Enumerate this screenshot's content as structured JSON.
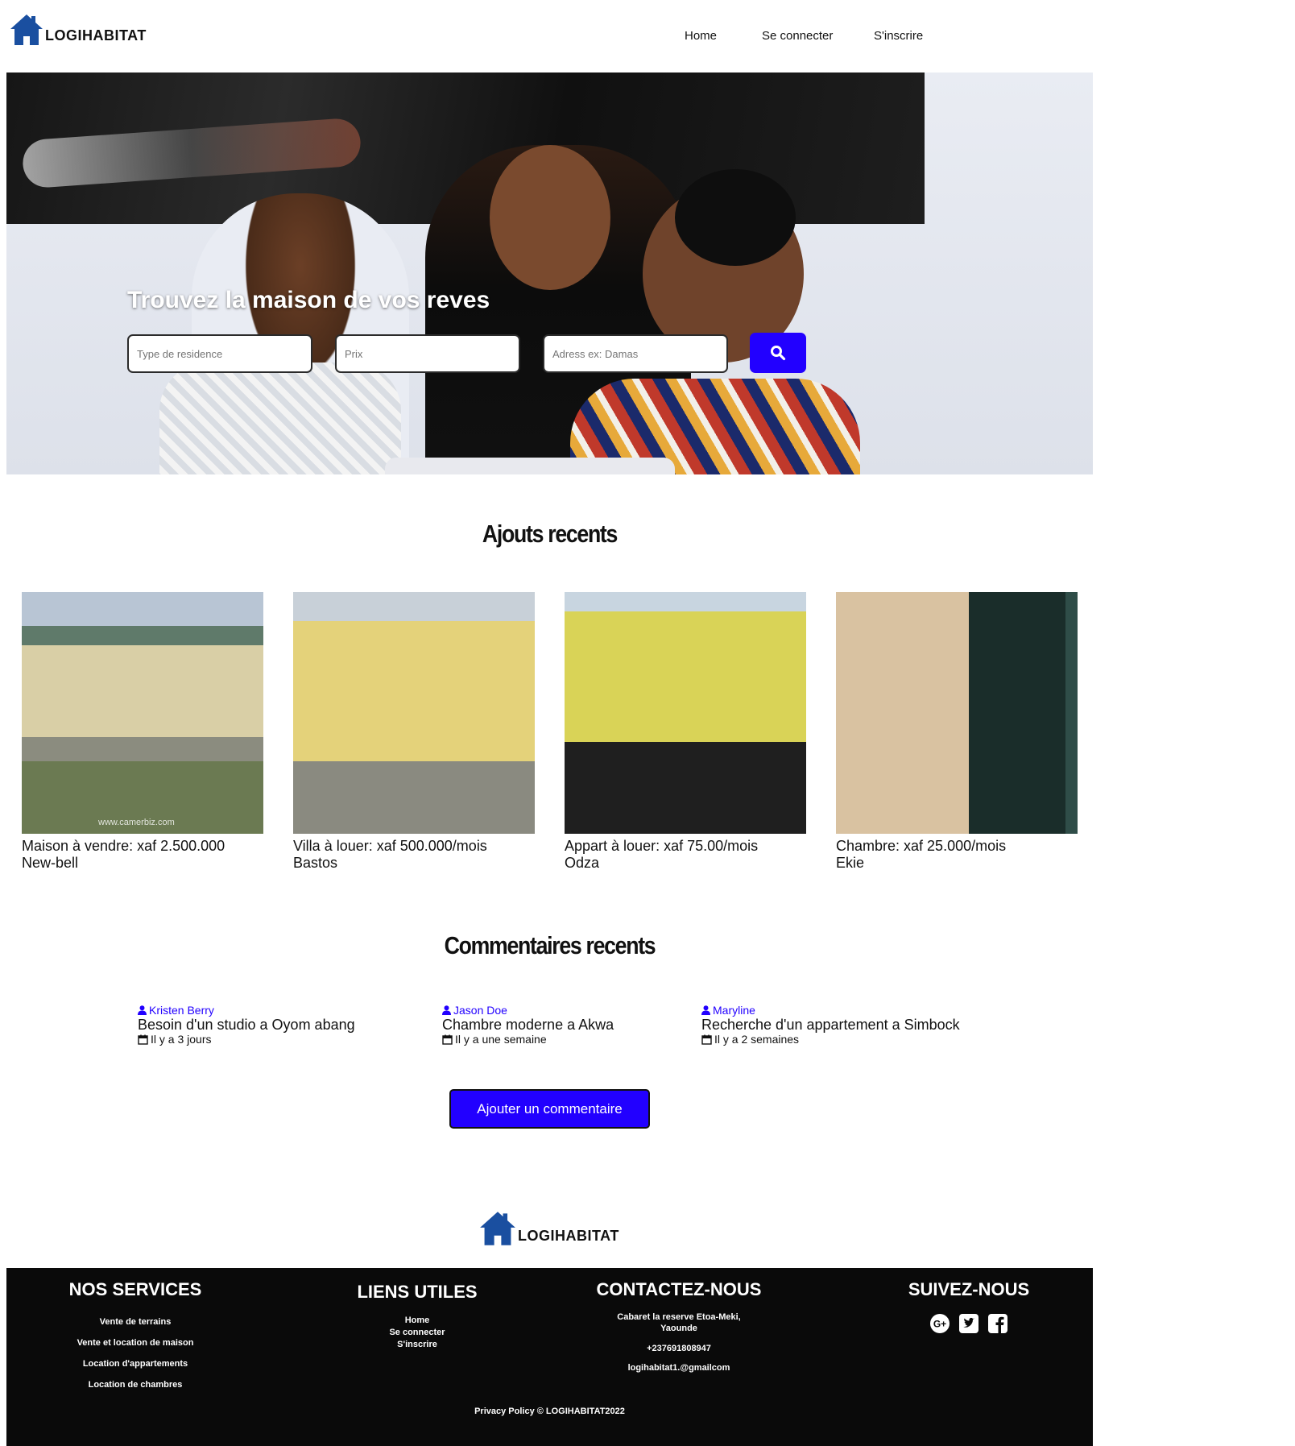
{
  "brand": {
    "name": "LOGIHABITAT",
    "logo_icon": "house-icon",
    "accent": "#2200ff",
    "logo_blue": "#1a4fa0"
  },
  "nav": {
    "items": [
      "Home",
      "Se connecter",
      "S'inscrire"
    ]
  },
  "hero": {
    "title": "Trouvez la maison de vos reves",
    "fields": [
      {
        "placeholder": "Type de residence"
      },
      {
        "placeholder": "Prix"
      },
      {
        "placeholder": "Adress ex: Damas"
      }
    ],
    "search_icon": "search-icon"
  },
  "recent": {
    "title": "Ajouts recents",
    "cards": [
      {
        "line1": "Maison à vendre: xaf 2.500.000",
        "line2": "New-bell",
        "watermark": "www.camerbiz.com"
      },
      {
        "line1": "Villa à louer: xaf 500.000/mois",
        "line2": "Bastos"
      },
      {
        "line1": "Appart à louer: xaf 75.00/mois",
        "line2": "Odza"
      },
      {
        "line1": "Chambre: xaf 25.000/mois",
        "line2": "Ekie"
      }
    ]
  },
  "comments": {
    "title": "Commentaires recents",
    "items": [
      {
        "author": "Kristen Berry",
        "text": "Besoin d'un studio a Oyom abang",
        "when": "Il y a 3 jours"
      },
      {
        "author": "Jason Doe",
        "text": "Chambre moderne a Akwa",
        "when": "Il y a une semaine"
      },
      {
        "author": "Maryline",
        "text": "Recherche d'un appartement a Simbock",
        "when": "Il y a 2 semaines"
      }
    ],
    "add_button": "Ajouter un commentaire"
  },
  "footer": {
    "services": {
      "title": "NOS SERVICES",
      "items": [
        "Vente de terrains",
        "Vente et location de maison",
        "Location d'appartements",
        "Location de chambres"
      ]
    },
    "links": {
      "title": "LIENS UTILES",
      "items": [
        "Home",
        "Se connecter",
        "S'inscrire"
      ]
    },
    "contact": {
      "title": "CONTACTEZ-NOUS",
      "address_line1": "Cabaret la reserve Etoa-Meki,",
      "address_line2": "Yaounde",
      "phone": "+237691808947",
      "email": "logihabitat1.@gmailcom"
    },
    "follow": {
      "title": "SUIVEZ-NOUS",
      "icons": [
        "google-plus-icon",
        "twitter-icon",
        "facebook-icon"
      ]
    },
    "privacy": "Privacy Policy © LOGIHABITAT2022"
  }
}
